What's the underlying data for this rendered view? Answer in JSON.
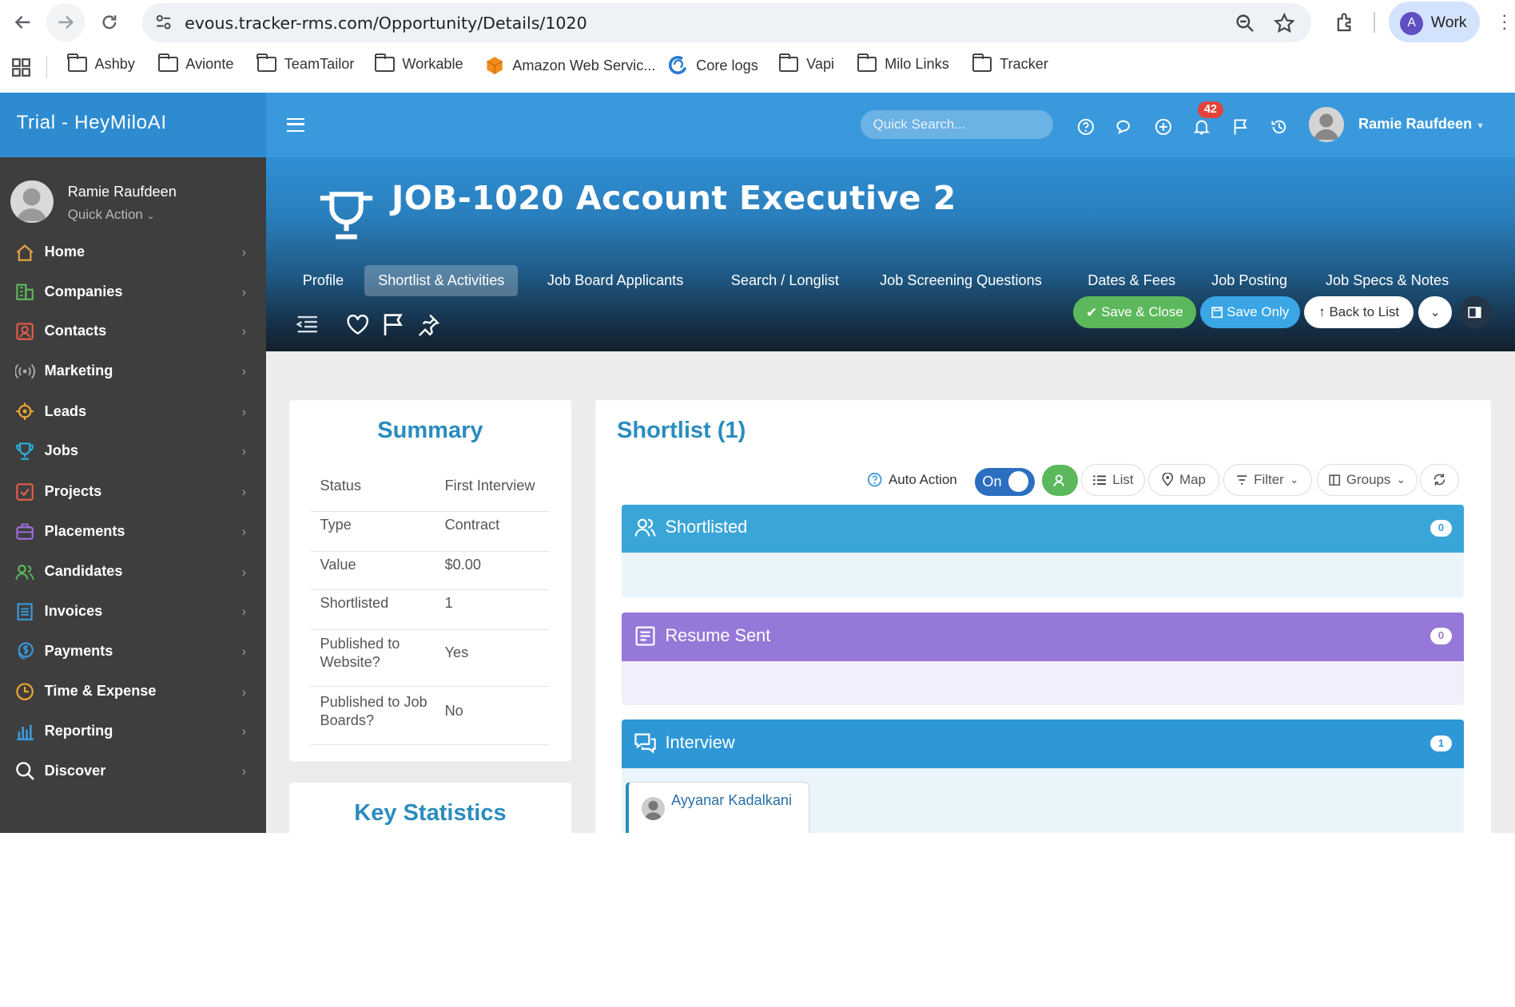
{
  "browser": {
    "url": "evous.tracker-rms.com/Opportunity/Details/1020",
    "profile_initial": "A",
    "profile_label": "Work",
    "bookmarks": [
      "Ashby",
      "Avionte",
      "TeamTailor",
      "Workable",
      "Amazon Web Servic...",
      "Core logs",
      "Vapi",
      "Milo Links",
      "Tracker"
    ]
  },
  "app": {
    "brand": "Trial - HeyMiloAI",
    "quick_search_placeholder": "Quick Search...",
    "notifications_count": "42",
    "user_name": "Ramie Raufdeen"
  },
  "sidebar": {
    "user_name": "Ramie Raufdeen",
    "quick_action": "Quick Action",
    "items": [
      {
        "label": "Home",
        "icon": "home-icon",
        "color": "#e8a33d"
      },
      {
        "label": "Companies",
        "icon": "building-icon",
        "color": "#5cb85c"
      },
      {
        "label": "Contacts",
        "icon": "contact-card-icon",
        "color": "#e85c4a"
      },
      {
        "label": "Marketing",
        "icon": "broadcast-icon",
        "color": "#aaaaaa"
      },
      {
        "label": "Leads",
        "icon": "target-icon",
        "color": "#f0a830"
      },
      {
        "label": "Jobs",
        "icon": "trophy-icon",
        "color": "#2ab0d8"
      },
      {
        "label": "Projects",
        "icon": "checkbox-icon",
        "color": "#e85c4a"
      },
      {
        "label": "Placements",
        "icon": "briefcase-icon",
        "color": "#9b6fd8"
      },
      {
        "label": "Candidates",
        "icon": "users-icon",
        "color": "#5cb85c"
      },
      {
        "label": "Invoices",
        "icon": "invoice-icon",
        "color": "#3a99dc"
      },
      {
        "label": "Payments",
        "icon": "coins-icon",
        "color": "#3a99dc"
      },
      {
        "label": "Time & Expense",
        "icon": "clock-icon",
        "color": "#f0a830"
      },
      {
        "label": "Reporting",
        "icon": "bar-chart-icon",
        "color": "#3a99dc"
      },
      {
        "label": "Discover",
        "icon": "search-icon",
        "color": "#ffffff"
      }
    ]
  },
  "job": {
    "title": "JOB-1020 Account Executive 2",
    "tabs": [
      "Profile",
      "Shortlist & Activities",
      "Job Board Applicants",
      "Search / Longlist",
      "Job Screening Questions",
      "Dates & Fees",
      "Job Posting",
      "Job Specs & Notes"
    ],
    "active_tab": "Shortlist & Activities",
    "buttons": {
      "save_close": "Save & Close",
      "save_only": "Save Only",
      "back_to_list": "Back to List"
    }
  },
  "summary": {
    "title": "Summary",
    "rows": [
      {
        "key": "Status",
        "value": "First Interview"
      },
      {
        "key": "Type",
        "value": "Contract"
      },
      {
        "key": "Value",
        "value": "$0.00"
      },
      {
        "key": "Shortlisted",
        "value": "1"
      },
      {
        "key": "Published to Website?",
        "value": "Yes"
      },
      {
        "key": "Published to Job Boards?",
        "value": "No"
      }
    ]
  },
  "key_statistics": {
    "title": "Key Statistics"
  },
  "shortlist": {
    "title": "Shortlist (1)",
    "auto_action": "Auto Action",
    "toggle": "On",
    "view_list": "List",
    "view_map": "Map",
    "filter": "Filter",
    "groups": "Groups",
    "stages": [
      {
        "label": "Shortlisted",
        "count": "0",
        "color": "#3aa6d8",
        "body": "#eaf5fb"
      },
      {
        "label": "Resume Sent",
        "count": "0",
        "color": "#9678d8",
        "body": "#f2eefb"
      },
      {
        "label": "Interview",
        "count": "1",
        "color": "#2e97d6",
        "body": "#eaf5fb"
      }
    ],
    "candidate": "Ayyanar Kadalkani"
  }
}
